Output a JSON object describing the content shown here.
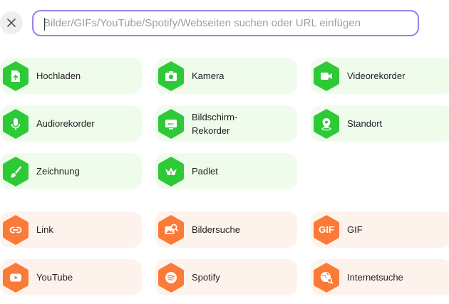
{
  "search": {
    "placeholder": "Bilder/GIFs/YouTube/Spotify/Webseiten suchen oder URL einfügen",
    "value": ""
  },
  "colors": {
    "green_tile": "#effcec",
    "green_icon": "#2ec937",
    "orange_tile": "#fef3ec",
    "orange_icon": "#fb7a38",
    "search_border": "#9b7ce8"
  },
  "tiles": {
    "upload": {
      "label": "Hochladen",
      "icon": "upload-file-icon"
    },
    "camera": {
      "label": "Kamera",
      "icon": "camera-icon"
    },
    "video": {
      "label": "Videorekorder",
      "icon": "video-camera-icon"
    },
    "audio": {
      "label": "Audiorekorder",
      "icon": "microphone-icon"
    },
    "screen": {
      "label_line1": "Bildschirm-",
      "label_line2": "Rekorder",
      "icon": "screen-record-icon"
    },
    "location": {
      "label": "Standort",
      "icon": "location-pin-icon"
    },
    "drawing": {
      "label": "Zeichnung",
      "icon": "brush-icon"
    },
    "padlet": {
      "label": "Padlet",
      "icon": "padlet-icon"
    },
    "link": {
      "label": "Link",
      "icon": "link-icon"
    },
    "image_search": {
      "label": "Bildersuche",
      "icon": "image-search-icon"
    },
    "gif": {
      "label": "GIF",
      "icon_text": "GIF",
      "icon": "gif-icon"
    },
    "youtube": {
      "label": "YouTube",
      "icon": "youtube-icon"
    },
    "spotify": {
      "label": "Spotify",
      "icon": "spotify-icon"
    },
    "web_search": {
      "label": "Internetsuche",
      "icon": "globe-search-icon"
    }
  }
}
